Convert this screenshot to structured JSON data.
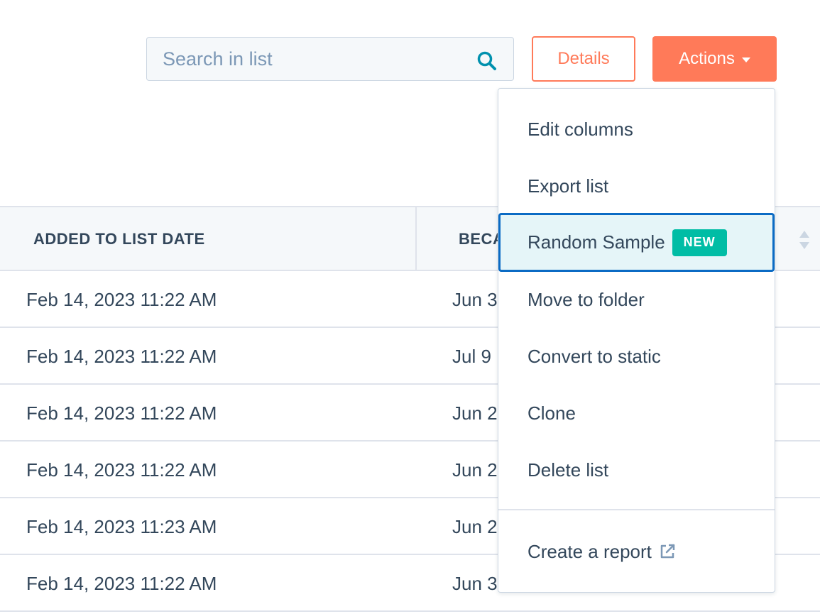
{
  "toolbar": {
    "search_placeholder": "Search in list",
    "details_label": "Details",
    "actions_label": "Actions"
  },
  "table": {
    "columns": [
      "ADDED TO LIST DATE",
      "BECA"
    ],
    "rows": [
      [
        "Feb 14, 2023 11:22 AM",
        "Jun 3"
      ],
      [
        "Feb 14, 2023 11:22 AM",
        "Jul 9"
      ],
      [
        "Feb 14, 2023 11:22 AM",
        "Jun 2"
      ],
      [
        "Feb 14, 2023 11:22 AM",
        "Jun 2"
      ],
      [
        "Feb 14, 2023 11:23 AM",
        "Jun 2"
      ],
      [
        "Feb 14, 2023 11:22 AM",
        "Jun 3"
      ]
    ]
  },
  "actions_menu": {
    "items": [
      {
        "label": "Edit columns"
      },
      {
        "label": "Export list"
      },
      {
        "label": "Random Sample",
        "badge": "NEW",
        "highlighted": true
      },
      {
        "label": "Move to folder"
      },
      {
        "label": "Convert to static"
      },
      {
        "label": "Clone"
      },
      {
        "label": "Delete list"
      }
    ],
    "footer_item": {
      "label": "Create a report",
      "icon": "external-link-icon"
    }
  },
  "colors": {
    "accent": "#ff7a59",
    "badge": "#00bda5",
    "focus": "#0b6bc4",
    "search_icon": "#0091ae",
    "text": "#33475b"
  }
}
